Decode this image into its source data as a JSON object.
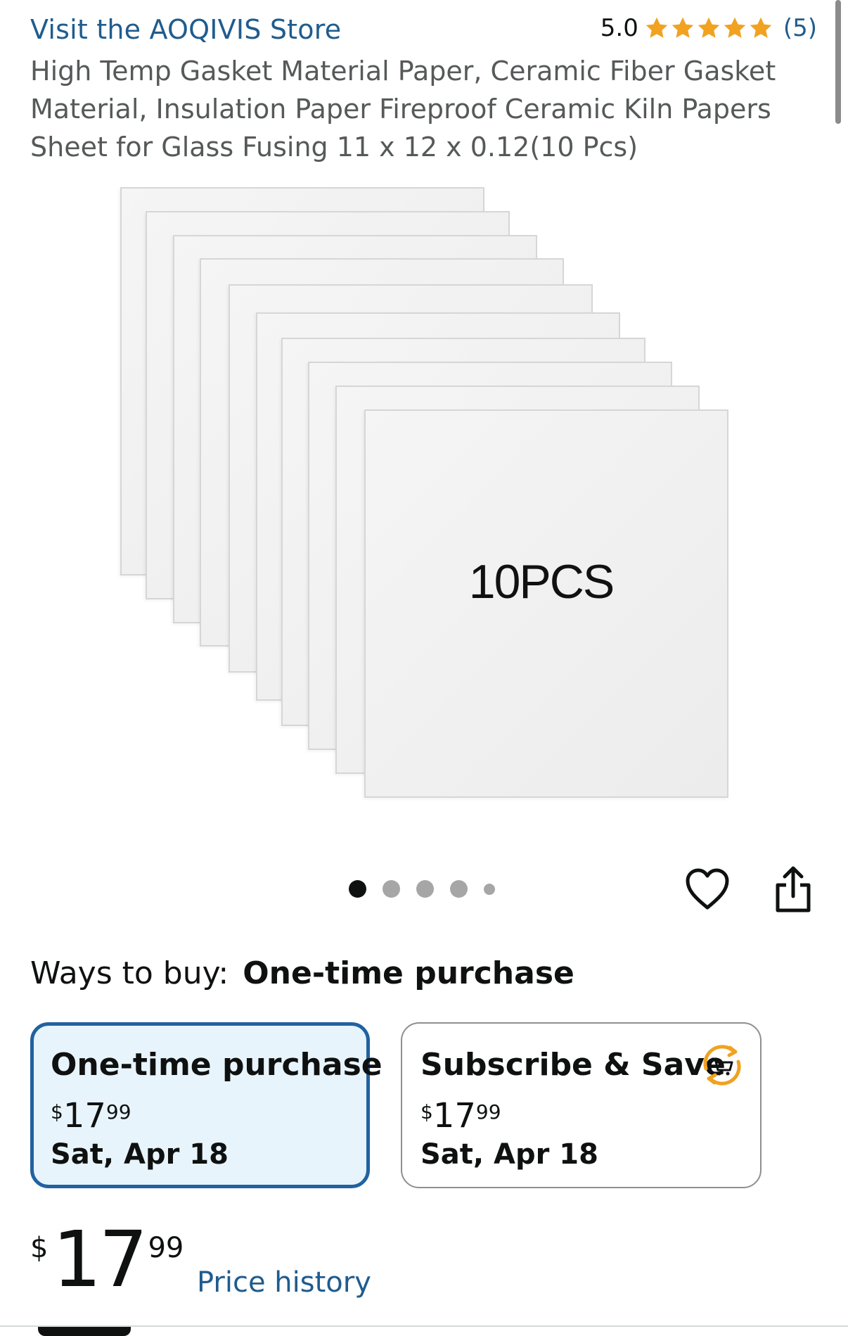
{
  "store": {
    "link_text": "Visit the AOQIVIS Store"
  },
  "rating": {
    "score": "5.0",
    "stars": 5,
    "count": "(5)",
    "star_color": "#f0a220"
  },
  "product": {
    "title": "High Temp Gasket Material Paper, Ceramic Fiber Gasket Material, Insulation Paper Fireproof Ceramic Kiln Papers Sheet for Glass Fusing 11 x 12 x 0.12(10 Pcs)"
  },
  "gallery": {
    "image_text": "10PCS",
    "total_images": 5,
    "active_index": 0
  },
  "actions": {
    "favorite_icon": "heart-icon",
    "share_icon": "share-icon"
  },
  "ways_to_buy": {
    "label": "Ways to buy:",
    "selected": "One-time purchase",
    "options": [
      {
        "title": "One-time purchase",
        "currency": "$",
        "whole": "17",
        "cents": "99",
        "date": "Sat, Apr 18",
        "selected": true
      },
      {
        "title": "Subscribe & Save",
        "currency": "$",
        "whole": "17",
        "cents": "99",
        "date": "Sat, Apr 18",
        "selected": false,
        "icon": "subscribe-cart-icon"
      }
    ]
  },
  "price": {
    "currency": "$",
    "whole": "17",
    "cents": "99"
  },
  "price_history_link": "Price history",
  "colors": {
    "link": "#1f5c8e",
    "selected_border": "#2162a1",
    "selected_bg": "#e8f4fb",
    "accent_orange": "#f0a220"
  }
}
